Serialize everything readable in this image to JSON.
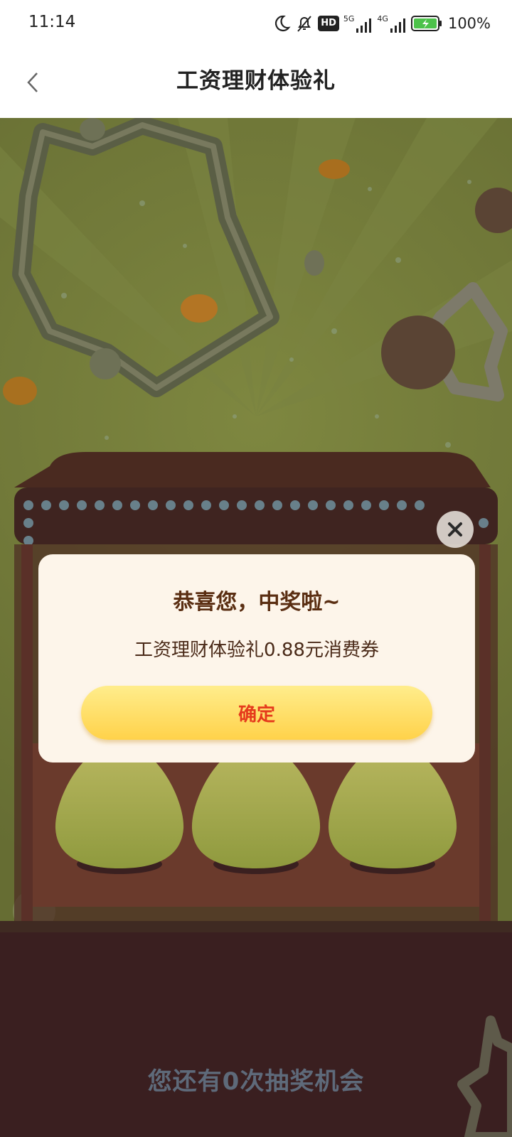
{
  "status_bar": {
    "time": "11:14",
    "network_badge": "HD",
    "signal_1_label": "5G",
    "signal_2_label": "4G",
    "battery_percent": "100%",
    "icons": [
      "moon-icon",
      "bell-off-icon",
      "hd-icon",
      "signal-5g-icon",
      "signal-4g-icon",
      "battery-charging-icon"
    ]
  },
  "nav": {
    "title": "工资理财体验礼",
    "back_icon": "chevron-left-icon"
  },
  "page": {
    "lottery_hint": "您还有0次抽奖机会"
  },
  "dialog": {
    "title": "恭喜您，中奖啦~",
    "prize_text": "工资理财体验礼0.88元消费券",
    "confirm_label": "确定",
    "close_icon": "close-icon"
  },
  "colors": {
    "dim_background": "#6d7336",
    "dialog_background": "#fdf5ea",
    "button_gradient_top": "#ffed8c",
    "button_gradient_bottom": "#ffd24a",
    "button_text": "#e53a1c",
    "title_text": "#5a2e12"
  }
}
